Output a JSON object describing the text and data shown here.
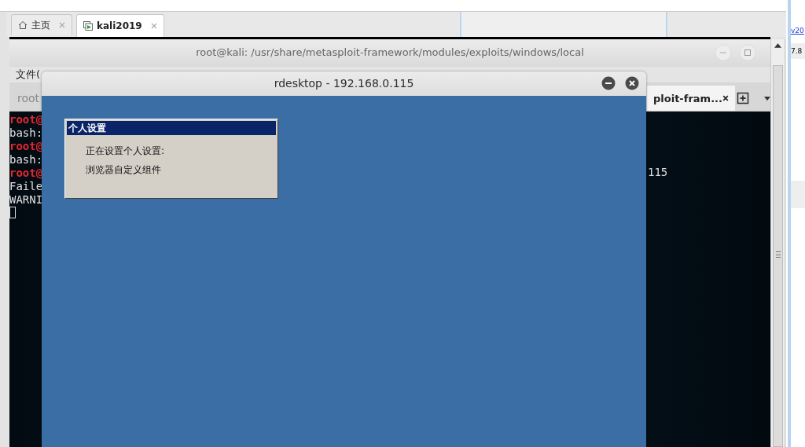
{
  "vm_tabs": [
    {
      "label": "主页",
      "selected": false
    },
    {
      "label": "kali2019",
      "selected": true
    }
  ],
  "terminal": {
    "title": "root@kali: /usr/share/metasploit-framework/modules/exploits/windows/local",
    "menu": [
      "文件("
    ],
    "tabs": [
      {
        "label": "root",
        "selected": false
      },
      {
        "label": "ploit-fram...",
        "selected": true
      }
    ],
    "lines": [
      {
        "text": "root@",
        "kind": "prompt"
      },
      {
        "text": "bash:",
        "kind": "output"
      },
      {
        "text": "root@",
        "kind": "prompt"
      },
      {
        "text": "bash:",
        "kind": "output"
      },
      {
        "text": "root@",
        "kind": "prompt"
      },
      {
        "text": "Faile",
        "kind": "output"
      },
      {
        "text": "WARNI",
        "kind": "output"
      }
    ],
    "right_text": "115"
  },
  "rdesktop": {
    "title": "rdesktop - 192.168.0.115",
    "dialog": {
      "title": "个人设置",
      "lines": [
        "正在设置个人设置:",
        "浏览器自定义组件"
      ]
    }
  },
  "side": {
    "link": "v20",
    "value": "7.8"
  }
}
